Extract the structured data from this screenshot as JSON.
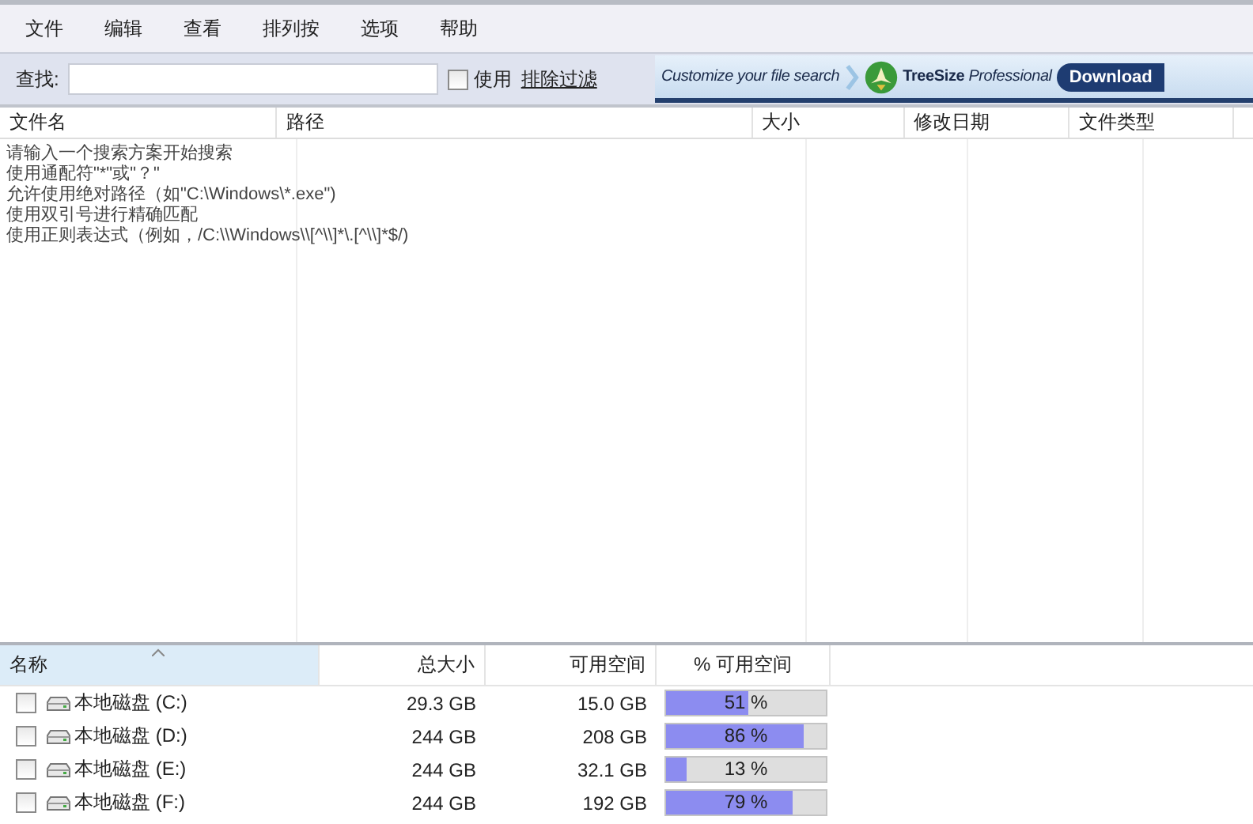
{
  "menu": [
    "文件",
    "编辑",
    "查看",
    "排列按",
    "选项",
    "帮助"
  ],
  "search": {
    "label": "查找:",
    "use_filter": {
      "label": "使用",
      "checked": false
    },
    "filter_link": "排除过滤"
  },
  "banner": {
    "tagline": "Customize your file search",
    "product": "TreeSize",
    "edition": "Professional",
    "button": "Download"
  },
  "results": {
    "columns": [
      "文件名",
      "路径",
      "大小",
      "修改日期",
      "文件类型"
    ],
    "hints": [
      "请输入一个搜索方案开始搜索",
      "使用通配符\"*\"或\"？\"",
      "允许使用绝对路径（如\"C:\\Windows\\*.exe\")",
      "使用双引号进行精确匹配",
      "使用正则表达式（例如，/C:\\\\Windows\\\\[^\\\\]*\\.[^\\\\]*$/)"
    ]
  },
  "drives": {
    "columns": [
      "名称",
      "总大小",
      "可用空间",
      "% 可用空间"
    ],
    "rows": [
      {
        "name": "本地磁盘 (C:)",
        "checked": false,
        "total": "29.3 GB",
        "free": "15.0 GB",
        "percent": "51 %",
        "level": 0.51
      },
      {
        "name": "本地磁盘 (D:)",
        "checked": false,
        "total": "244 GB",
        "free": "208 GB",
        "percent": "86 %",
        "level": 0.86
      },
      {
        "name": "本地磁盘 (E:)",
        "checked": false,
        "total": "244 GB",
        "free": "32.1 GB",
        "percent": "13 %",
        "level": 0.13
      },
      {
        "name": "本地磁盘 (F:)",
        "checked": false,
        "total": "244 GB",
        "free": "192 GB",
        "percent": "79 %",
        "level": 0.79
      }
    ]
  }
}
